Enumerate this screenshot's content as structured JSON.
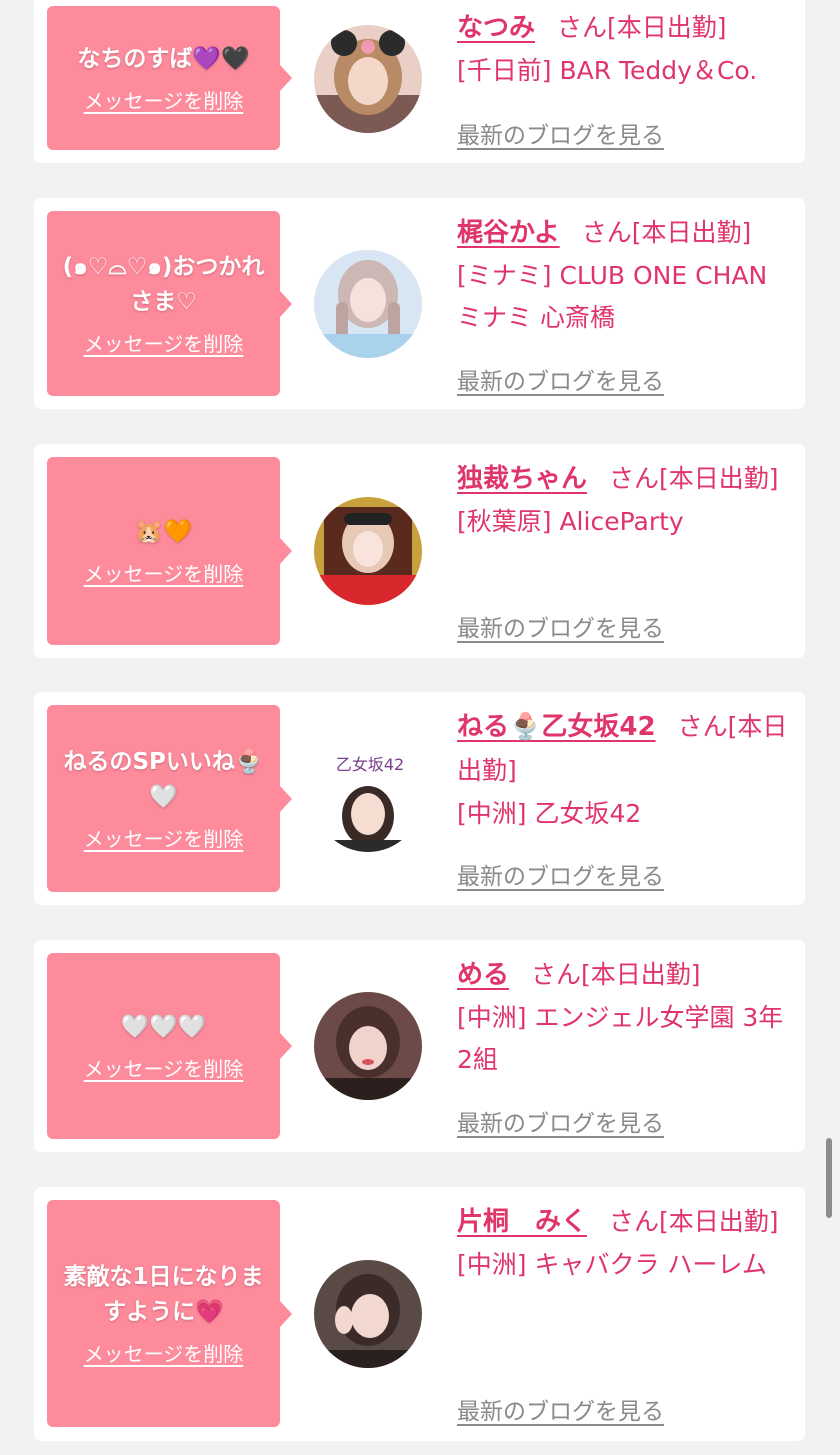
{
  "colors": {
    "page_background": "#f2f2f2",
    "card_background": "#ffffff",
    "bubble_pink": "#fd8b9c",
    "name_pink": "#e0356a",
    "blog_gray": "#8a8a8a"
  },
  "cards": [
    {
      "message": "なちのすば💜🖤",
      "delete_label": "メッセージを削除",
      "name": "なつみ",
      "honorific": "さん",
      "status": "[本日出勤]",
      "shop": "[千日前] BAR Teddy＆Co.",
      "blog_label": "最新のブログを見る",
      "avatar_icon": "profile-photo-icon"
    },
    {
      "message": "(๑♡⌓♡๑)おつかれさま♡",
      "delete_label": "メッセージを削除",
      "name": "梶谷かよ",
      "honorific": "さん",
      "status": "[本日出勤]",
      "shop": "[ミナミ] CLUB ONE CHAN ミナミ 心斎橋",
      "blog_label": "最新のブログを見る",
      "avatar_icon": "profile-photo-icon"
    },
    {
      "message": "🐹🧡",
      "delete_label": "メッセージを削除",
      "name": "独裁ちゃん",
      "honorific": "さん",
      "status": "[本日出勤]",
      "shop": "[秋葉原] AliceParty",
      "blog_label": "最新のブログを見る",
      "avatar_icon": "profile-photo-icon"
    },
    {
      "message": "ねるのSPいいね🍨🤍",
      "delete_label": "メッセージを削除",
      "name": "ねる🍨乙女坂42",
      "honorific": "さん",
      "status": "[本日出勤]",
      "shop": "[中洲] 乙女坂42",
      "blog_label": "最新のブログを見る",
      "avatar_icon": "profile-photo-icon",
      "avatar_caption": "乙女坂42"
    },
    {
      "message": "🤍🤍🤍",
      "delete_label": "メッセージを削除",
      "name": "める",
      "honorific": "さん",
      "status": "[本日出勤]",
      "shop": "[中洲] エンジェル女学園 3年2組",
      "blog_label": "最新のブログを見る",
      "avatar_icon": "profile-photo-icon"
    },
    {
      "message": "素敵な1日になりますように💗",
      "delete_label": "メッセージを削除",
      "name": "片桐　みく",
      "honorific": "さん",
      "status": "[本日出勤]",
      "shop": "[中洲] キャバクラ ハーレム",
      "blog_label": "最新のブログを見る",
      "avatar_icon": "profile-photo-icon"
    }
  ]
}
